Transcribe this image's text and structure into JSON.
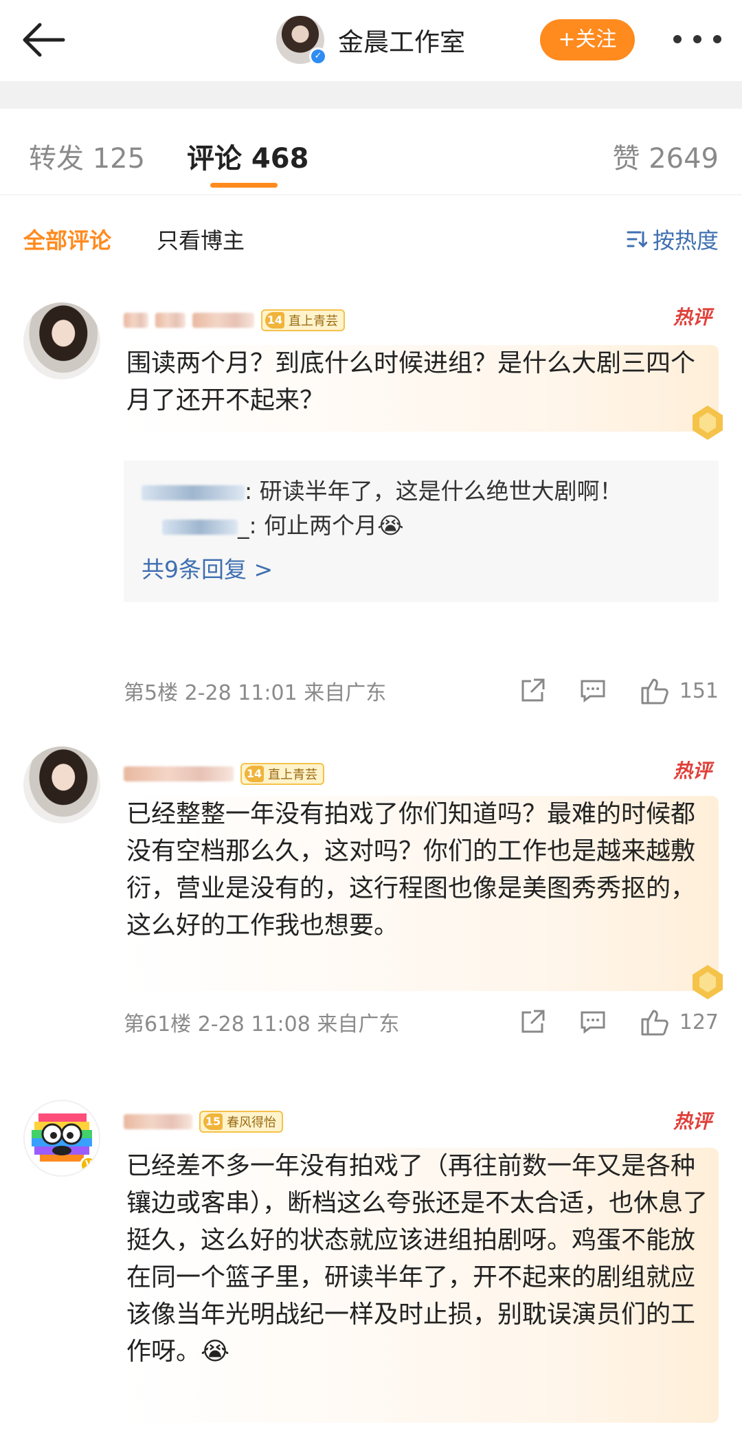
{
  "header": {
    "account_name": "金晨工作室",
    "follow_label": "+关注"
  },
  "tabs": [
    {
      "label": "转发 125"
    },
    {
      "label": "评论 468"
    },
    {
      "label": "赞 2649"
    }
  ],
  "filters": {
    "all": "全部评论",
    "author_only": "只看博主",
    "sort": "按热度"
  },
  "comments": [
    {
      "level": "14",
      "badge": "直上青芸",
      "hot": "热评",
      "text": "围读两个月？到底什么时候进组？是什么大剧三四个月了还开不起来？",
      "replies": [
        {
          "tail": ": 研读半年了，这是什么绝世大剧啊！"
        },
        {
          "tail": "_: 何止两个月😭"
        }
      ],
      "more_replies": "共9条回复 >",
      "meta": "第5楼  2-28 11:01  来自广东",
      "likes": "151"
    },
    {
      "level": "14",
      "badge": "直上青芸",
      "hot": "热评",
      "text": "已经整整一年没有拍戏了你们知道吗？最难的时候都没有空档那么久，这对吗？你们的工作也是越来越敷衍，营业是没有的，这行程图也像是美图秀秀抠的，这么好的工作我也想要。",
      "meta": "第61楼  2-28 11:08  来自广东",
      "likes": "127"
    },
    {
      "level": "15",
      "badge": "春风得怡",
      "hot": "热评",
      "text": "已经差不多一年没有拍戏了（再往前数一年又是各种镶边或客串），断档这么夸张还是不太合适，也休息了挺久，这么好的状态就应该进组拍剧呀。鸡蛋不能放在同一个篮子里，研读半年了，开不起来的剧组就应该像当年光明战纪一样及时止损，别耽误演员们的工作呀。😭"
    }
  ]
}
